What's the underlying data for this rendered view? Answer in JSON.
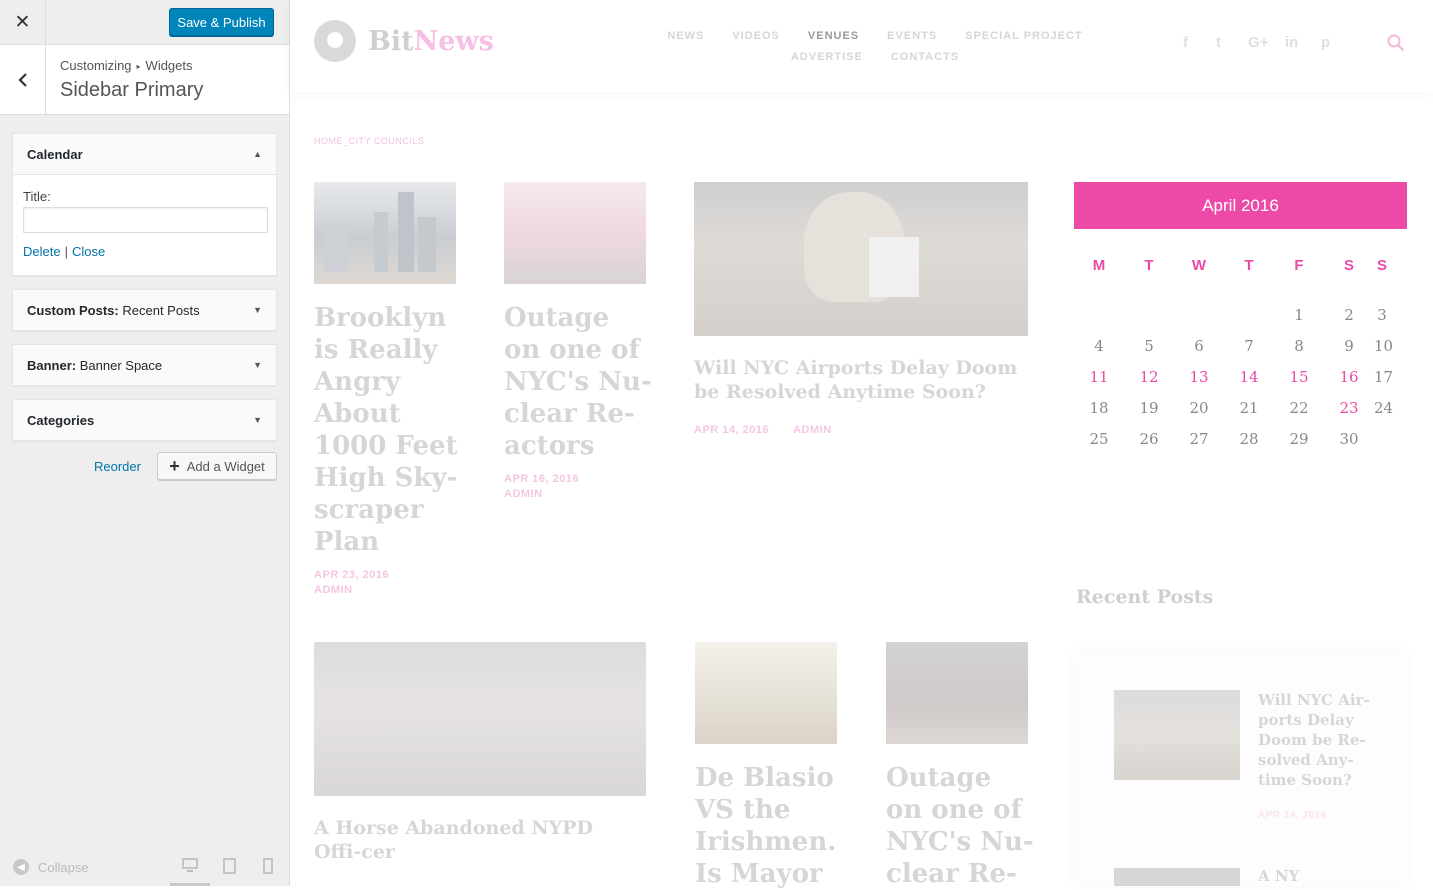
{
  "customizer": {
    "close_icon": "close-icon",
    "save_label": "Save & Publish",
    "breadcrumb": [
      "Customizing",
      "Widgets"
    ],
    "section_title": "Sidebar Primary",
    "widgets": [
      {
        "name": "Calendar",
        "type": "",
        "expanded": true
      },
      {
        "name": "Custom Posts:",
        "type": "Recent Posts",
        "expanded": false
      },
      {
        "name": "Banner:",
        "type": "Banner Space",
        "expanded": false
      },
      {
        "name": "Categories",
        "type": "",
        "expanded": false
      }
    ],
    "calendar_form": {
      "title_label": "Title:",
      "title_value": "",
      "delete_label": "Delete",
      "separator": "|",
      "close_label": "Close"
    },
    "reorder_label": "Reorder",
    "add_widget_label": "Add a Widget",
    "collapse_label": "Collapse",
    "accent_color": "#0085ba"
  },
  "site": {
    "logo": {
      "bit": "Bit",
      "news": "News"
    },
    "nav": [
      "NEWS",
      "VIDEOS",
      "VENUES",
      "EVENTS",
      "SPECIAL PROJECT",
      "ADVERTISE",
      "CONTACTS"
    ],
    "nav_active": "VENUES",
    "social_icons": [
      "facebook-icon",
      "twitter-icon",
      "google-plus-icon",
      "linkedin-icon",
      "pinterest-icon"
    ],
    "social_glyphs": [
      "f",
      "t",
      "G+",
      "in",
      "p"
    ],
    "breadcrumb": "HOME_CITY COUNCILS",
    "brand_color": "#ec4aa6",
    "posts": [
      {
        "title": "Brooklyn is Really Angry About 1000 Feet High Sky-scraper Plan",
        "date": "APR 23, 2016",
        "author": "ADMIN"
      },
      {
        "title": "Outage on one of NYC's Nu-clear Re-actors",
        "date": "APR 16, 2016",
        "author": "ADMIN"
      },
      {
        "title": "Will NYC Airports Delay Doom be Resolved Anytime Soon?",
        "date": "APR 14, 2016",
        "author": "ADMIN"
      },
      {
        "title": "A Horse Abandoned NYPD Offi-cer",
        "date": "",
        "author": ""
      },
      {
        "title": "De Blasio VS the Irishmen. Is Mayor",
        "date": "",
        "author": ""
      },
      {
        "title": "Outage on one of NYC's Nu-clear Re-",
        "date": "",
        "author": ""
      }
    ],
    "calendar": {
      "month": "April 2016",
      "days": [
        "M",
        "T",
        "W",
        "T",
        "F",
        "S",
        "S"
      ],
      "weeks": [
        [
          "",
          "",
          "",
          "",
          "1",
          "2",
          "3"
        ],
        [
          "4",
          "5",
          "6",
          "7",
          "8",
          "9",
          "10"
        ],
        [
          "11",
          "12",
          "13",
          "14",
          "15",
          "16",
          "17"
        ],
        [
          "18",
          "19",
          "20",
          "21",
          "22",
          "23",
          "24"
        ],
        [
          "25",
          "26",
          "27",
          "28",
          "29",
          "30",
          ""
        ]
      ],
      "highlighted": [
        "11",
        "12",
        "13",
        "14",
        "15",
        "16",
        "23"
      ]
    },
    "recent_posts": {
      "title": "Recent Posts",
      "items": [
        {
          "title": "Will NYC Air-ports Delay Doom be Re-solved Any-time Soon?",
          "date": "APR 14, 2016"
        },
        {
          "title": "A NY",
          "date": ""
        }
      ]
    }
  }
}
